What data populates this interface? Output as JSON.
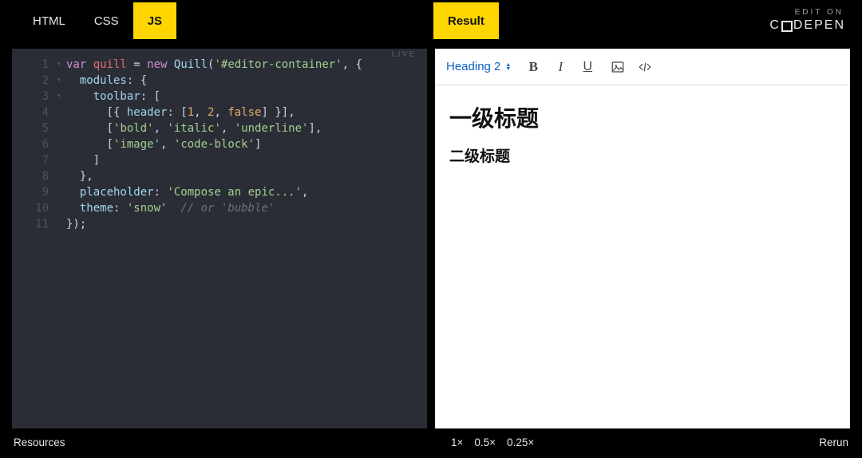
{
  "header": {
    "tabs": {
      "html": "HTML",
      "css": "CSS",
      "js": "JS"
    },
    "result_tab": "Result",
    "brand_edit": "EDIT ON",
    "brand_name_left": "C",
    "brand_name_right": "DEPEN"
  },
  "live_badge": "LIVE",
  "code": {
    "l1": {
      "kw1": "var ",
      "id": "quill",
      "op": " = ",
      "kw2": "new ",
      "cls": "Quill",
      "p1": "(",
      "str": "'#editor-container'",
      "p2": ", {"
    },
    "l2": {
      "indent": "  ",
      "prop": "modules",
      "after": ": {"
    },
    "l3": {
      "indent": "    ",
      "prop": "toolbar",
      "after": ": ["
    },
    "l4": {
      "indent": "      [{ ",
      "prop": "header",
      "mid": ": [",
      "n1": "1",
      "c1": ", ",
      "n2": "2",
      "c2": ", ",
      "n3": "false",
      "end": "] }],"
    },
    "l5": {
      "indent": "      [",
      "s1": "'bold'",
      "c1": ", ",
      "s2": "'italic'",
      "c2": ", ",
      "s3": "'underline'",
      "end": "],"
    },
    "l6": {
      "indent": "      [",
      "s1": "'image'",
      "c1": ", ",
      "s2": "'code-block'",
      "end": "]"
    },
    "l7": {
      "text": "    ]"
    },
    "l8": {
      "text": "  },"
    },
    "l9": {
      "indent": "  ",
      "prop": "placeholder",
      "mid": ": ",
      "str": "'Compose an epic...'",
      "end": ","
    },
    "l10": {
      "indent": "  ",
      "prop": "theme",
      "mid": ": ",
      "str": "'snow'",
      "sp": "  ",
      "cmnt": "// or 'bubble'"
    },
    "l11": {
      "text": "});"
    }
  },
  "gutter": {
    "1": "1",
    "2": "2",
    "3": "3",
    "4": "4",
    "5": "5",
    "6": "6",
    "7": "7",
    "8": "8",
    "9": "9",
    "10": "10",
    "11": "11"
  },
  "fold": {
    "open": "▾",
    "none": " "
  },
  "result": {
    "picker_label": "Heading 2",
    "buttons": {
      "bold": "B",
      "italic": "I",
      "underline": "U"
    },
    "content": {
      "h1": "一级标题",
      "h2": "二级标题"
    }
  },
  "footer": {
    "resources": "Resources",
    "zoom1": "1×",
    "zoom05": "0.5×",
    "zoom025": "0.25×",
    "rerun": "Rerun"
  }
}
